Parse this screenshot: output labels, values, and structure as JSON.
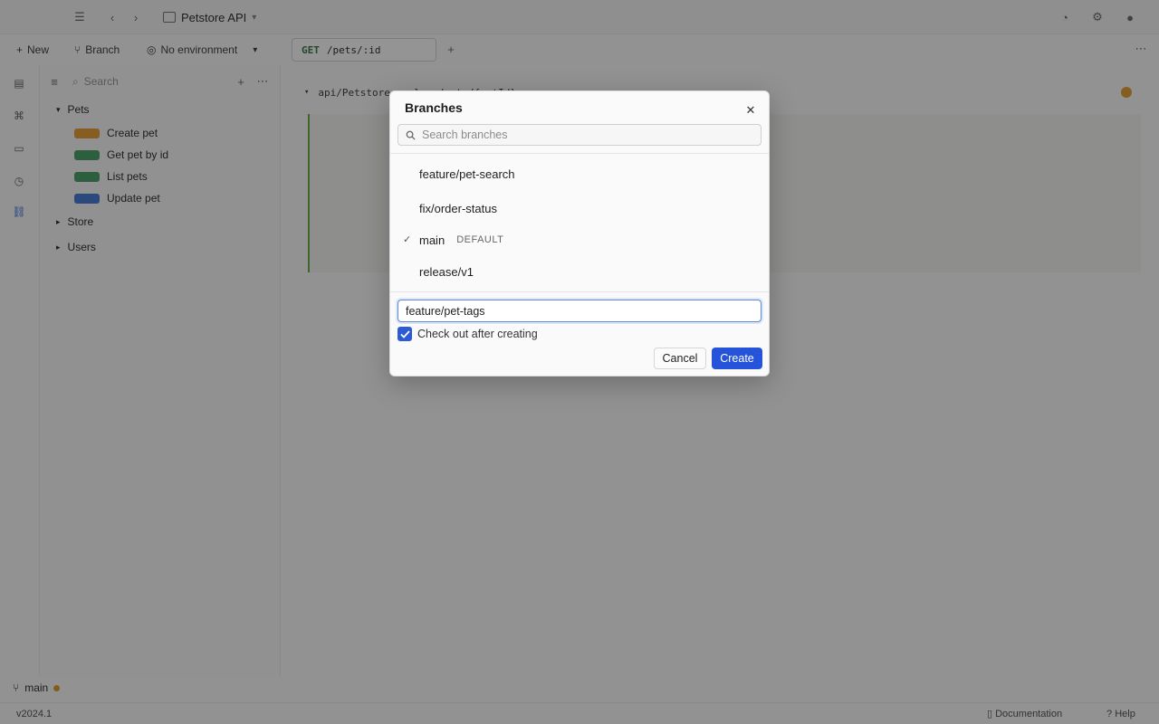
{
  "app": {
    "project_name": "Petstore API",
    "toolbar": {
      "new_label": "New",
      "branch_label": "Branch",
      "environment_label": "No environment"
    },
    "tab": {
      "method": "GET",
      "label": "/pets/:id"
    },
    "sidebar": {
      "search_placeholder": "Search",
      "folders": [
        {
          "label": "Pets"
        },
        {
          "label": "Store"
        },
        {
          "label": "Users"
        }
      ],
      "requests": [
        {
          "label": "Create pet",
          "method": "post"
        },
        {
          "label": "Get pet by id",
          "method": "get"
        },
        {
          "label": "List pets",
          "method": "get"
        },
        {
          "label": "Update pet",
          "method": "put"
        }
      ],
      "git_branch": "main"
    },
    "editor": {
      "method": "GET",
      "url": "api/Petstore.yaml - /pets/{petId}"
    },
    "statusbar": {
      "left": "v2024.1",
      "documentation": "Documentation",
      "help": "Help"
    }
  },
  "dialog": {
    "title": "Branches",
    "close_icon": "close-icon",
    "search_placeholder": "Search branches",
    "branches": [
      {
        "name": "feature/pet-search",
        "current": false,
        "badge": ""
      },
      {
        "name": "fix/order-status",
        "current": false,
        "badge": ""
      },
      {
        "name": "main",
        "current": true,
        "badge": "DEFAULT"
      },
      {
        "name": "release/v1",
        "current": false,
        "badge": ""
      }
    ],
    "new_branch_value": "feature/pet-tags",
    "checkout_label": "Check out after creating",
    "checkout_checked": true,
    "cancel_label": "Cancel",
    "create_label": "Create",
    "colors": {
      "primary": "#2553d9",
      "focus": "#5b8bd9"
    }
  }
}
